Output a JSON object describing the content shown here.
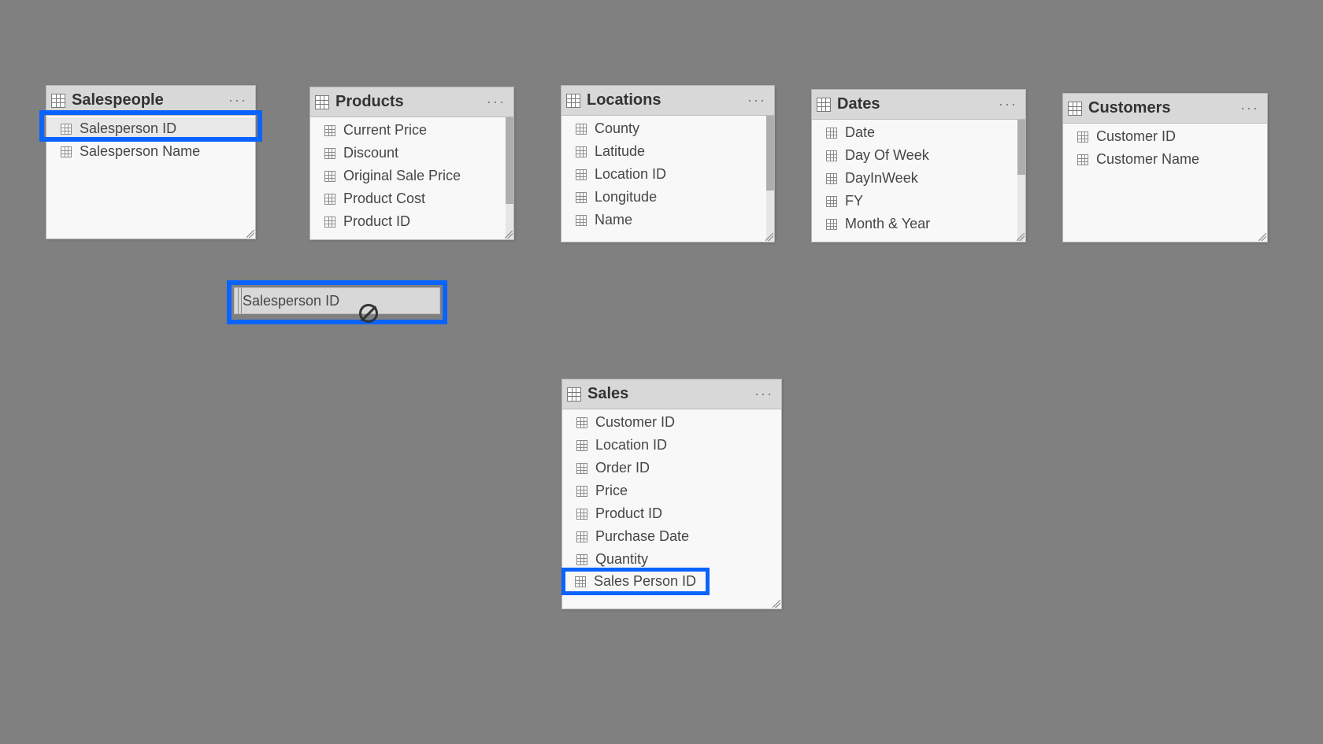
{
  "colors": {
    "highlight": "#0b63ff",
    "canvas_bg": "#808080"
  },
  "drag": {
    "label": "Salesperson ID",
    "cursor": "no-drop"
  },
  "tables": {
    "salespeople": {
      "title": "Salespeople",
      "fields": [
        "Salesperson ID",
        "Salesperson Name"
      ],
      "highlighted_field_index": 0
    },
    "products": {
      "title": "Products",
      "fields": [
        "Current Price",
        "Discount",
        "Original Sale Price",
        "Product Cost",
        "Product ID"
      ]
    },
    "locations": {
      "title": "Locations",
      "fields": [
        "County",
        "Latitude",
        "Location ID",
        "Longitude",
        "Name"
      ]
    },
    "dates": {
      "title": "Dates",
      "fields": [
        "Date",
        "Day Of Week",
        "DayInWeek",
        "FY",
        "Month & Year"
      ]
    },
    "customers": {
      "title": "Customers",
      "fields": [
        "Customer ID",
        "Customer Name"
      ]
    },
    "sales": {
      "title": "Sales",
      "fields": [
        "Customer ID",
        "Location ID",
        "Order ID",
        "Price",
        "Product ID",
        "Purchase Date",
        "Quantity",
        "Sales Person ID"
      ],
      "highlighted_field_index": 7
    }
  }
}
